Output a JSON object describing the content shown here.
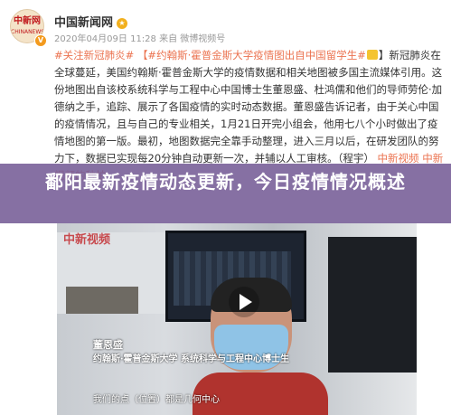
{
  "account": {
    "logo_text": "中新网",
    "logo_sub": "CHINANEWS.COM",
    "name": "中国新闻网",
    "meta": "2020年04月09日 11:28  来自 微博视频号"
  },
  "post": {
    "tag1": "#关注新冠肺炎#",
    "tag2": "【#约翰斯·霍普金斯大学疫情图出自中国留学生#",
    "tag2_end": "】新冠肺炎在全球",
    "body": "蔓延，美国约翰斯·霍普金斯大学的疫情数据和相关地图被多国主流媒体引用。这份地图出自该校系统科学与工程中心中国博士生董恩盛、杜鸿儒和他们的导师劳伦·加德纳之手，追踪、展示了各国疫情的实时动态数据。董恩盛告诉记者，由于关心中国的疫情情况，且与自己的专业相关，1月21日开完小组会，他用七八个小时做出了疫情地图的第一版。最初，地图数据完全靠手动整理，进入三月以后，在研发团队的努力下，数据已实现每20分钟自动更新一次，并辅以人工审核。（程宇）",
    "link": "中新视频 中新视频的秒拍"
  },
  "banner": {
    "title": "鄱阳最新疫情动态更新，今日疫情情况概述"
  },
  "video": {
    "logo": "中新视频",
    "speaker_name": "董恩盛",
    "speaker_line": "约翰斯·霍普金斯大学 系统科学与工程中心博士生",
    "subtitle": "我们的点（位置）都是几何中心"
  }
}
